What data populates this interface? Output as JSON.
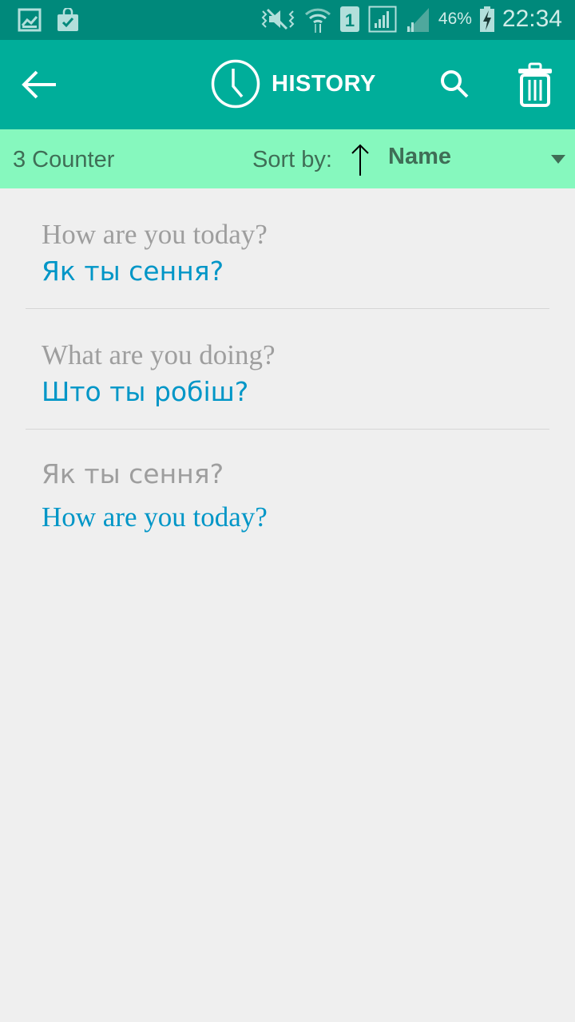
{
  "status_bar": {
    "left_icons": [
      "gallery-icon",
      "shopping-bag-check-icon"
    ],
    "right_icons": [
      "vibrate-mute-icon",
      "wifi-icon",
      "sim-1-icon",
      "signal-icon",
      "signal-2-icon",
      "battery-charging-icon"
    ],
    "battery_percent": "46%",
    "time": "22:34"
  },
  "app_bar": {
    "back_icon": "arrow-left-icon",
    "title_icon": "clock-icon",
    "title": "HISTORY",
    "search_icon": "search-icon",
    "delete_icon": "trash-icon"
  },
  "sub_bar": {
    "counter": "3 Counter",
    "sort_label": "Sort by:",
    "sort_direction": "ascending",
    "sort_value": "Name"
  },
  "history": [
    {
      "source": "How are you today?",
      "translation": "Як ты сення?"
    },
    {
      "source": "What are you doing?",
      "translation": "Што ты робіш?"
    },
    {
      "source": "Як ты сення?",
      "translation": "How are you today?"
    }
  ],
  "colors": {
    "status_bar": "#00897b",
    "app_bar": "#00ae9a",
    "sub_bar": "#86f8be",
    "source_text": "#9e9e9e",
    "translation_text": "#0096c7",
    "background": "#efefef"
  }
}
